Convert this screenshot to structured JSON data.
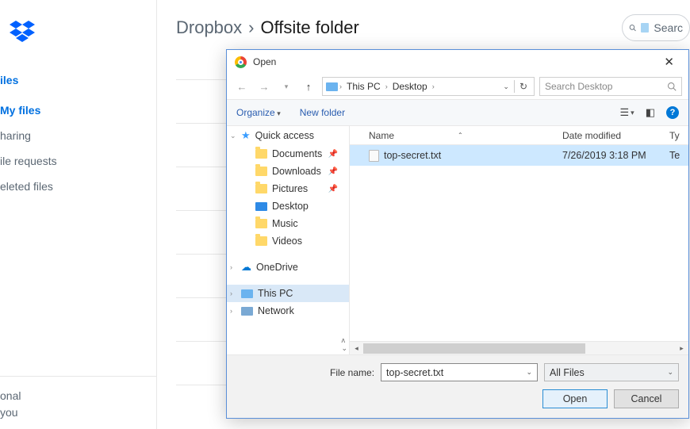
{
  "dropbox": {
    "breadcrumb_root": "Dropbox",
    "breadcrumb_sep": "›",
    "breadcrumb_current": "Offsite folder",
    "search_placeholder": "Searc",
    "sidebar_heading": "iles",
    "sidebar": {
      "items": [
        {
          "label": "My files",
          "active": true
        },
        {
          "label": "haring",
          "active": false
        },
        {
          "label": "ile requests",
          "active": false
        },
        {
          "label": "eleted files",
          "active": false
        }
      ]
    },
    "bottom_line1": "onal",
    "bottom_line2": "you"
  },
  "dialog": {
    "title": "Open",
    "address": {
      "root_icon": "this-pc",
      "segments": [
        "This PC",
        "Desktop"
      ]
    },
    "search_placeholder": "Search Desktop",
    "toolbar": {
      "organize": "Organize",
      "newfolder": "New folder"
    },
    "tree": [
      {
        "label": "Quick access",
        "icon": "star",
        "level": 1,
        "expandable": true
      },
      {
        "label": "Documents",
        "icon": "folder",
        "level": 2,
        "pinned": true
      },
      {
        "label": "Downloads",
        "icon": "folder",
        "level": 2,
        "pinned": true
      },
      {
        "label": "Pictures",
        "icon": "folder",
        "level": 2,
        "pinned": true
      },
      {
        "label": "Desktop",
        "icon": "desktop",
        "level": 2
      },
      {
        "label": "Music",
        "icon": "folder",
        "level": 2
      },
      {
        "label": "Videos",
        "icon": "folder",
        "level": 2
      },
      {
        "label": "OneDrive",
        "icon": "onedrive",
        "level": 1,
        "gap": true,
        "expandable": true
      },
      {
        "label": "This PC",
        "icon": "pc",
        "level": 1,
        "gap": true,
        "selected": true,
        "expandable": true
      },
      {
        "label": "Network",
        "icon": "net",
        "level": 1,
        "expandable": true
      }
    ],
    "columns": {
      "name": "Name",
      "date": "Date modified",
      "type": "Ty"
    },
    "files": [
      {
        "name": "top-secret.txt",
        "date": "7/26/2019 3:18 PM",
        "type": "Te",
        "selected": true
      }
    ],
    "footer": {
      "filename_label": "File name:",
      "filename_value": "top-secret.txt",
      "filter": "All Files",
      "open": "Open",
      "cancel": "Cancel"
    }
  }
}
